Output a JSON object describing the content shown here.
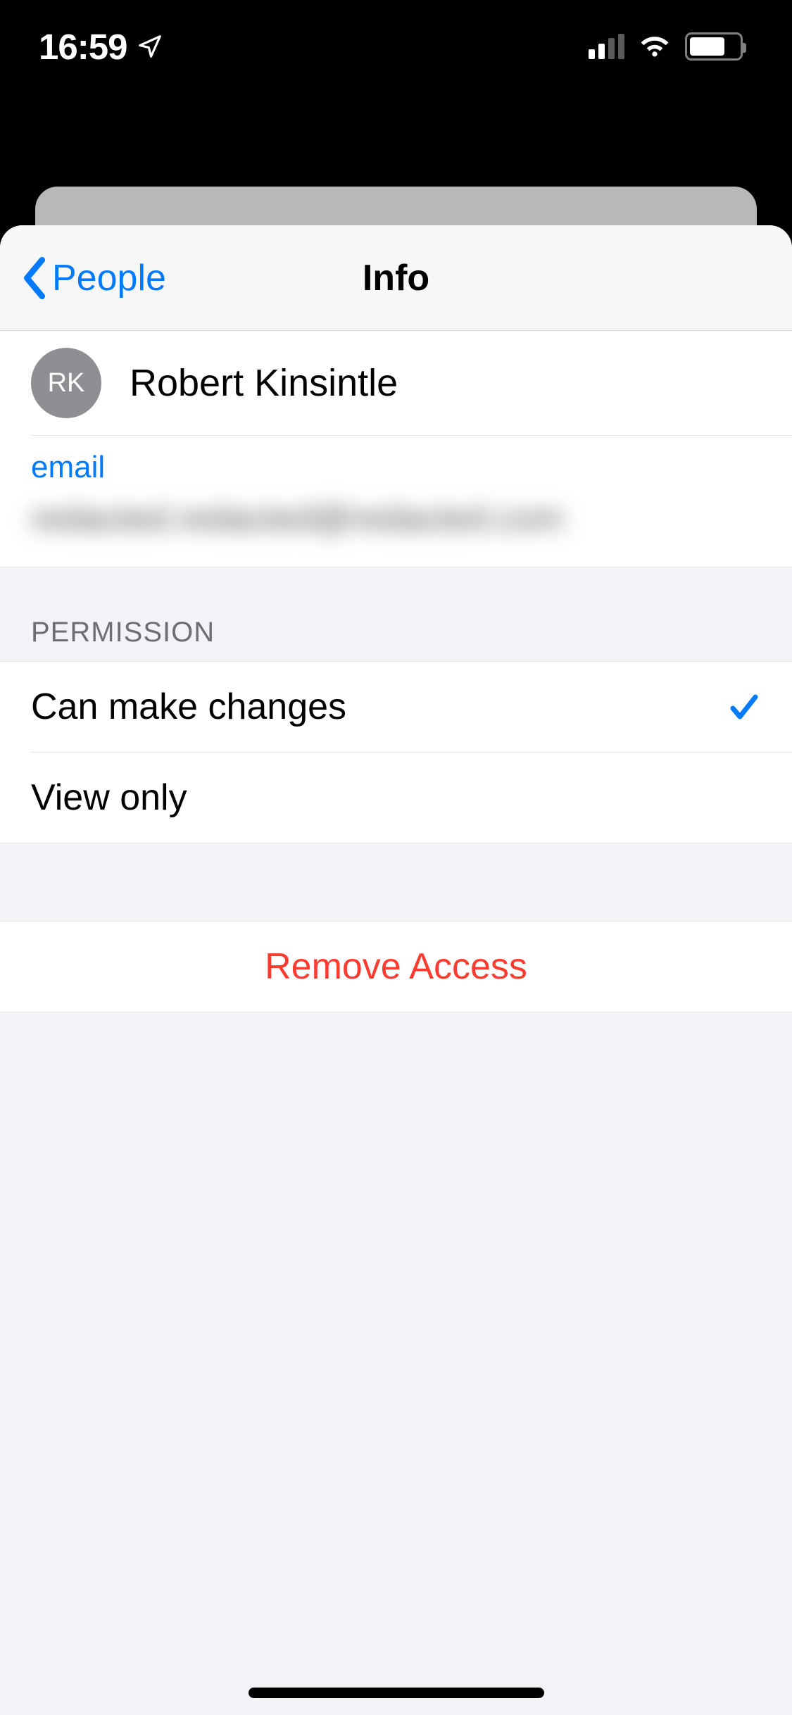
{
  "status": {
    "time": "16:59"
  },
  "nav": {
    "back_label": "People",
    "title": "Info"
  },
  "contact": {
    "initials": "RK",
    "name": "Robert Kinsintle",
    "email_label": "email",
    "email_value": "redacted.redacted@redacted.com"
  },
  "permission": {
    "header": "Permission",
    "options": [
      {
        "label": "Can make changes",
        "selected": true
      },
      {
        "label": "View only",
        "selected": false
      }
    ]
  },
  "actions": {
    "remove_access": "Remove Access"
  }
}
